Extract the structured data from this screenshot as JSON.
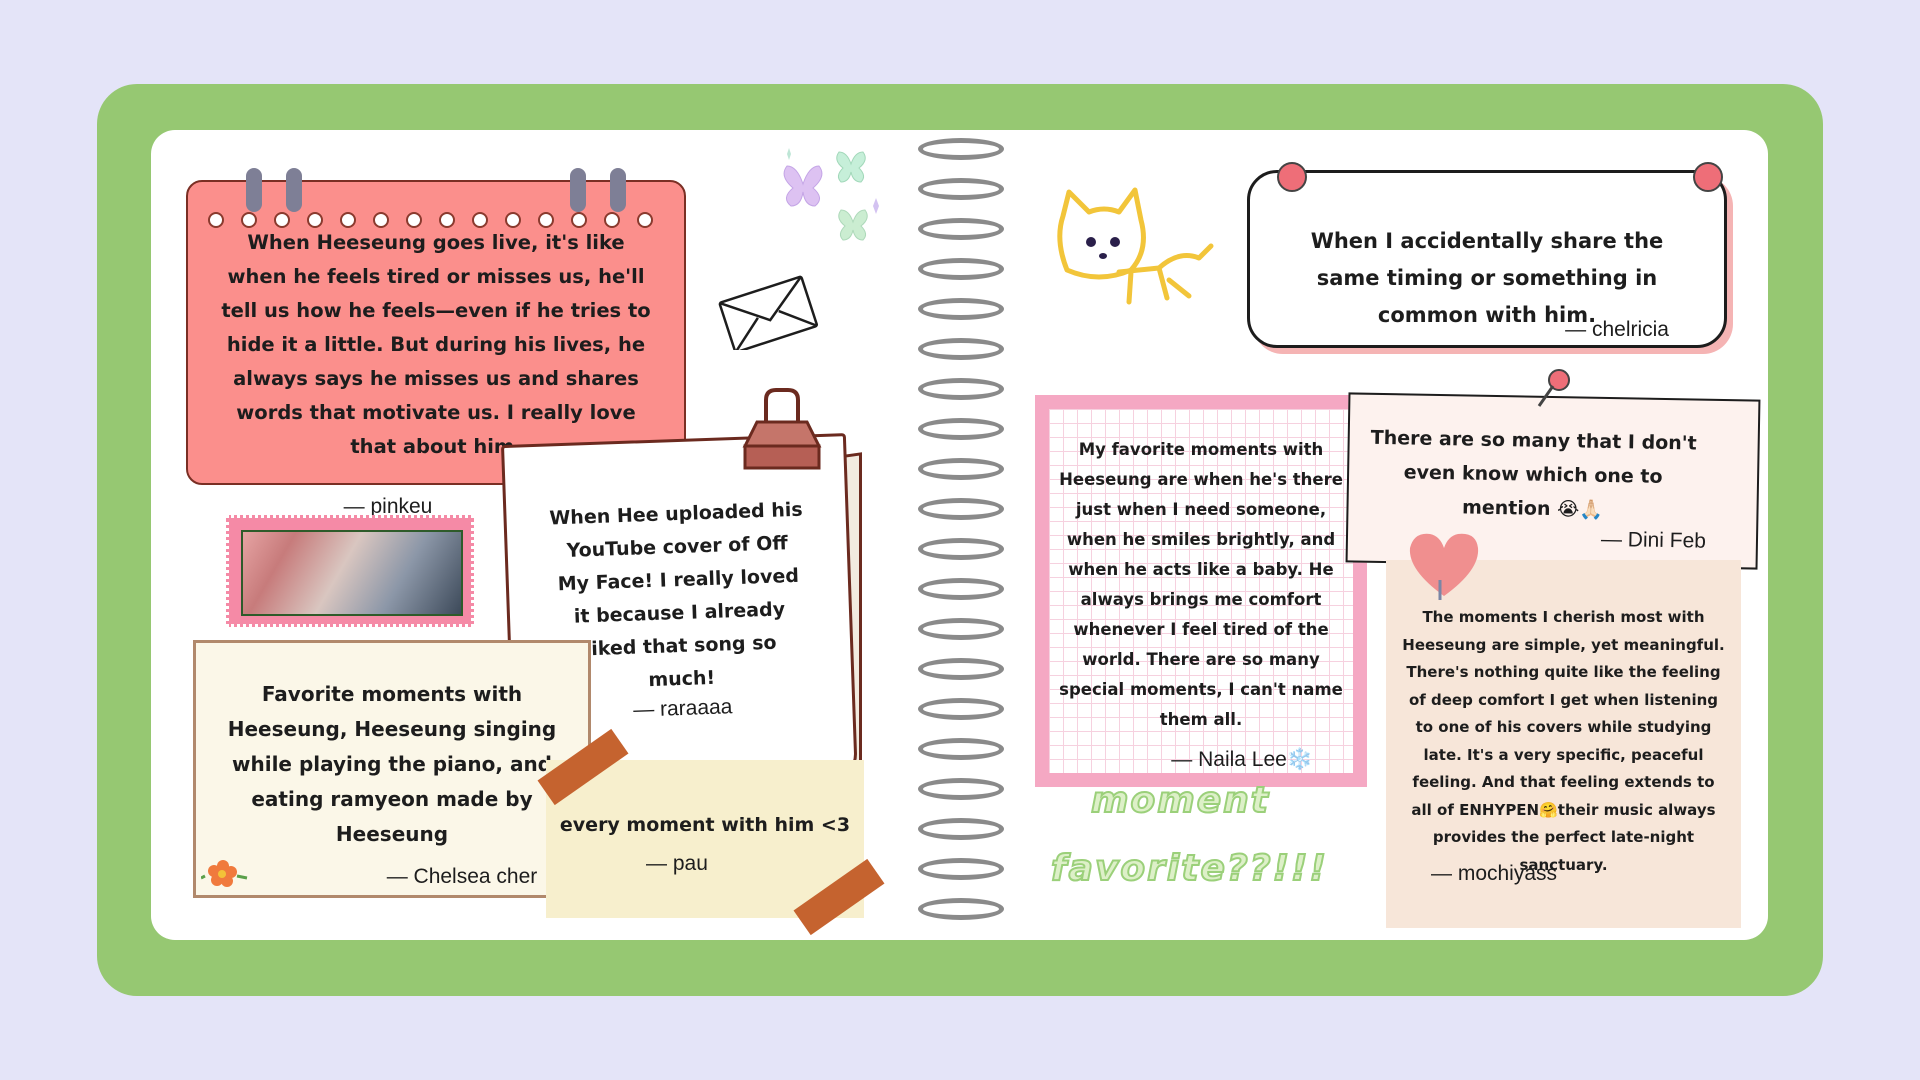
{
  "notes": {
    "pinkeu": {
      "text": "When Heeseung goes live, it's like when he feels tired or misses us, he'll tell us how he feels—even if he tries to hide it a little. But during his lives, he always says he misses us and shares words that motivate us. I really love that about him.",
      "author": "— pinkeu"
    },
    "raraaaa": {
      "text": "When Hee uploaded his YouTube cover of Off My Face! I really loved it because I already liked that song so much!",
      "author": "— raraaaa"
    },
    "chelsea": {
      "text": "Favorite moments with Heeseung, Heeseung singing while playing the piano, and eating ramyeon made by Heeseung",
      "author": "— Chelsea cher"
    },
    "pau": {
      "text": "every moment with him <3",
      "author": "— pau"
    },
    "chelricia": {
      "text": "When I accidentally share the same timing or something in common with him.",
      "author": "— chelricia"
    },
    "naila": {
      "text": "My favorite moments with Heeseung are when he's there just when I need someone, when he smiles brightly, and when he acts like a baby. He always brings me comfort whenever I feel tired of the world. There are so many special moments, I can't name them all.",
      "author": "— Naila Lee❄️"
    },
    "dini": {
      "text": "There are so many that I don't even know which one to mention 😭🙏🏻",
      "author": "— Dini Feb"
    },
    "mochiyass": {
      "text": "The moments I cherish most with Heeseung are simple, yet meaningful. There's nothing quite like the feeling of deep comfort I get when listening to one of his covers while studying late. It's a very specific, peaceful feeling. And that feeling extends to all of ENHYPEN🤗their music always provides the perfect late-night sanctuary.",
      "author": "— mochiyass"
    }
  },
  "wordart": {
    "line1": "moment",
    "line2": "favorite??!!!"
  },
  "colors": {
    "frame": "#96c872",
    "background": "#e4e4f8",
    "pinkeu_note": "#fb8f8c",
    "naila_border": "#f5a8c3"
  },
  "icons": [
    "butterfly-icon",
    "envelope-icon",
    "cat-doodle-icon",
    "binder-clip-icon",
    "pushpin-icon",
    "heart-paperclip-icon",
    "flower-icon"
  ]
}
